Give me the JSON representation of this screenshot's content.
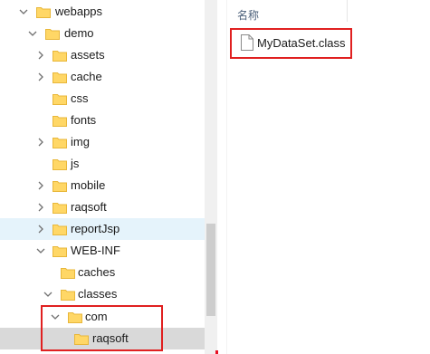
{
  "tree": {
    "items": [
      {
        "label": "webapps",
        "chevron": "down"
      },
      {
        "label": "demo",
        "chevron": "down"
      },
      {
        "label": "assets",
        "chevron": "right"
      },
      {
        "label": "cache",
        "chevron": "right"
      },
      {
        "label": "css",
        "chevron": "none"
      },
      {
        "label": "fonts",
        "chevron": "none"
      },
      {
        "label": "img",
        "chevron": "right"
      },
      {
        "label": "js",
        "chevron": "none"
      },
      {
        "label": "mobile",
        "chevron": "right"
      },
      {
        "label": "raqsoft",
        "chevron": "right"
      },
      {
        "label": "reportJsp",
        "chevron": "right",
        "state": "hover"
      },
      {
        "label": "WEB-INF",
        "chevron": "down"
      },
      {
        "label": "caches",
        "chevron": "none"
      },
      {
        "label": "classes",
        "chevron": "down"
      },
      {
        "label": "com",
        "chevron": "down"
      },
      {
        "label": "raqsoft",
        "chevron": "none",
        "state": "selected"
      }
    ]
  },
  "file_list": {
    "column_header": "名称",
    "files": [
      {
        "name": "MyDataSet.class",
        "icon": "file-icon"
      }
    ]
  },
  "colors": {
    "folder_fill": "#ffd766",
    "folder_tab": "#e8b73a",
    "highlight_border": "#e02020",
    "hover_bg": "#e5f3fb",
    "selected_bg": "#d9d9d9"
  }
}
